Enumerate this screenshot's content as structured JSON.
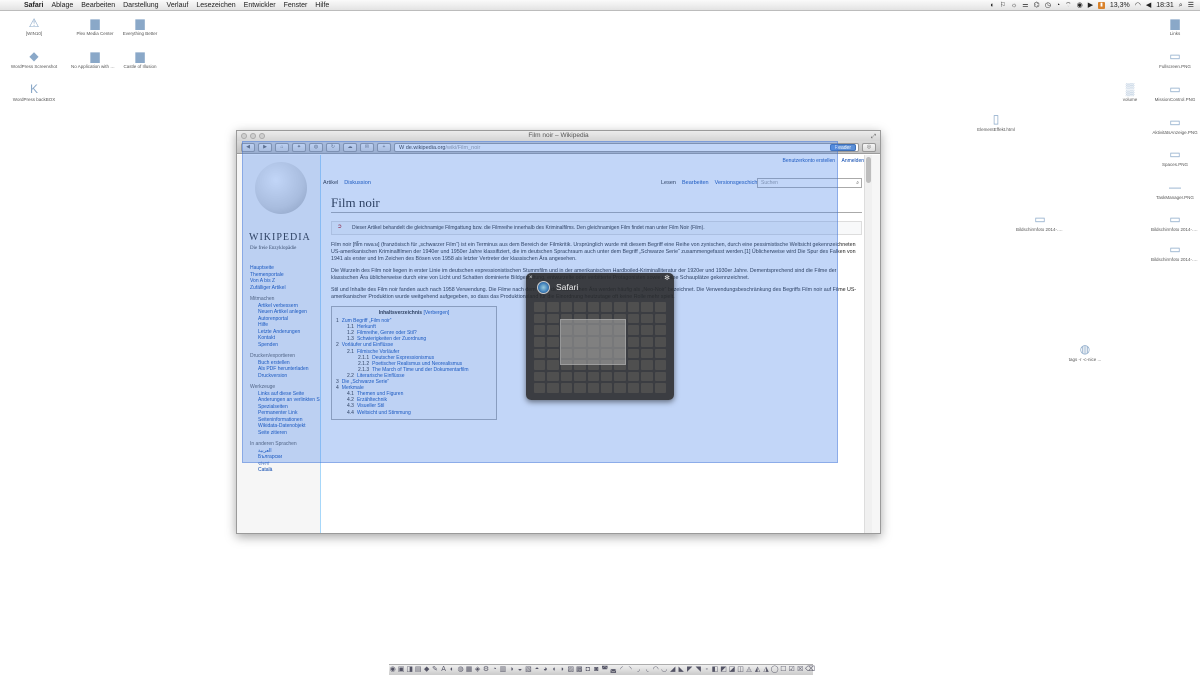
{
  "menubar": {
    "apple": "",
    "items": [
      "Safari",
      "Ablage",
      "Bearbeiten",
      "Darstellung",
      "Verlauf",
      "Lesezeichen",
      "Entwickler",
      "Fenster",
      "Hilfe"
    ],
    "battery_percent": "13,3%",
    "time": "18:31",
    "status_icons": [
      "◐",
      "⚐",
      "☼",
      "⚌",
      "⌬",
      "◷",
      "◔",
      "⌔",
      "◉",
      "▶"
    ]
  },
  "desktop": {
    "icons": [
      {
        "label": "[WIN10]",
        "glyph": "⚠"
      },
      {
        "label": "Plex Media Center",
        "glyph": "▆"
      },
      {
        "label": "Everything Better",
        "glyph": "▆"
      },
      {
        "label": "WordPress Screenshot",
        "glyph": "◆"
      },
      {
        "label": "No Application with WEBFAIL",
        "glyph": "▆"
      },
      {
        "label": "Castle of Illusion",
        "glyph": "▆"
      },
      {
        "label": "WordPress backBOX",
        "glyph": "K"
      },
      {
        "label": "Links",
        "glyph": "▆"
      },
      {
        "label": "Fullscreen.PNG",
        "glyph": "▭"
      },
      {
        "label": "volume",
        "glyph": "▒"
      },
      {
        "label": "MissionControl.PNG",
        "glyph": "▭"
      },
      {
        "label": "AktivitätsAnzeige.PNG",
        "glyph": "▭"
      },
      {
        "label": "Spaces.PNG",
        "glyph": "▭"
      },
      {
        "label": "TaskManager.PNG",
        "glyph": "—"
      },
      {
        "label": "Bildschirmfoto 2014-...18.09",
        "glyph": "▭"
      },
      {
        "label": "Bildschirmfoto 2014-...18.57.03",
        "glyph": "▭"
      },
      {
        "label": "ElementEffekt.html",
        "glyph": "▯"
      },
      {
        "label": "Bildschirmfoto 2014-...18.09.45",
        "glyph": "▭"
      },
      {
        "label": "tags -r -c-nice ...",
        "glyph": "◍"
      }
    ]
  },
  "window": {
    "title": "Film noir – Wikipedia",
    "address_host": "de.wikipedia.org",
    "address_path": "/wiki/Film_noir",
    "address_prefix": "W",
    "reader_label": "Reader",
    "toolbar_buttons": [
      "◀",
      "▶",
      "⌂",
      "✦",
      "◍",
      "↻",
      "☁",
      "✉",
      "+"
    ]
  },
  "wiki": {
    "wordmark": "WIKIPEDIA",
    "tagline": "Die freie Enzyklopädie",
    "personal": [
      "Benutzerkonto erstellen",
      "Anmelden"
    ],
    "tabs_left": [
      "Artikel",
      "Diskussion"
    ],
    "tabs_right": [
      "Lesen",
      "Bearbeiten",
      "Versionsgeschichte"
    ],
    "search_placeholder": "Suchen",
    "nav": [
      {
        "label": "Hauptseite",
        "type": "link"
      },
      {
        "label": "Themenportale",
        "type": "link"
      },
      {
        "label": "Von A bis Z",
        "type": "link"
      },
      {
        "label": "Zufälliger Artikel",
        "type": "link"
      },
      {
        "label": "Mitmachen",
        "type": "head"
      },
      {
        "label": "Artikel verbessern",
        "type": "sub"
      },
      {
        "label": "Neuen Artikel anlegen",
        "type": "sub"
      },
      {
        "label": "Autorenportal",
        "type": "sub"
      },
      {
        "label": "Hilfe",
        "type": "sub"
      },
      {
        "label": "Letzte Änderungen",
        "type": "sub"
      },
      {
        "label": "Kontakt",
        "type": "sub"
      },
      {
        "label": "Spenden",
        "type": "sub"
      },
      {
        "label": "Drucken/exportieren",
        "type": "head"
      },
      {
        "label": "Buch erstellen",
        "type": "sub"
      },
      {
        "label": "Als PDF herunterladen",
        "type": "sub"
      },
      {
        "label": "Druckversion",
        "type": "sub"
      },
      {
        "label": "Werkzeuge",
        "type": "head"
      },
      {
        "label": "Links auf diese Seite",
        "type": "sub"
      },
      {
        "label": "Änderungen an verlinkten Seiten",
        "type": "sub"
      },
      {
        "label": "Spezialseiten",
        "type": "sub"
      },
      {
        "label": "Permanenter Link",
        "type": "sub"
      },
      {
        "label": "Seiteninformationen",
        "type": "sub"
      },
      {
        "label": "Wikidata-Datenobjekt",
        "type": "sub"
      },
      {
        "label": "Seite zitieren",
        "type": "sub"
      },
      {
        "label": "In anderen Sprachen",
        "type": "head"
      },
      {
        "label": "العربية",
        "type": "sub"
      },
      {
        "label": "Български",
        "type": "sub"
      },
      {
        "label": "বাংলা",
        "type": "sub"
      },
      {
        "label": "Català",
        "type": "sub"
      }
    ],
    "title": "Film noir",
    "hatnote": "Dieser Artikel behandelt die gleichnamige Filmgattung bzw. die Filmreihe innerhalb des Kriminalfilms. Den gleichnamigen Film findet man unter Film Noir (Film).",
    "paragraphs": [
      "Film noir [fil̃m nwaːʁ] (französisch für „schwarzer Film“) ist ein Terminus aus dem Bereich der Filmkritik. Ursprünglich wurde mit diesem Begriff eine Reihe von zynischen, durch eine pessimistische Weltsicht gekennzeichneten US-amerikanischen Kriminalfilmen der 1940er und 1950er Jahre klassifiziert, die im deutschen Sprachraum auch unter dem Begriff „Schwarze Serie“ zusammengefasst werden.[1] Üblicherweise wird Die Spur des Falken von 1941 als erster und Im Zeichen des Bösen von 1958 als letzter Vertreter der klassischen Ära angesehen.",
      "Die Wurzeln des Film noir liegen in erster Linie im deutschen expressionistischen Stummfilm und in der amerikanischen Hardboiled-Kriminalliteratur der 1920er und 1930er Jahre. Dementsprechend sind die Filme der klassischen Ära üblicherweise durch eine von Licht und Schatten dominierte Bildgestaltung, entwurzelte oder verbitterte Protagonisten sowie urbane Schauplätze gekennzeichnet.",
      "Stil und Inhalte des Film noir fanden auch nach 1958 Verwendung. Die Filme nach dem Ende der klassischen Ära werden häufig als „Neo-Noir“ bezeichnet. Die Verwendungsbeschränkung des Begriffs Film noir auf Filme US-amerikanischer Produktion wurde weitgehend aufgegeben, so dass das Produktionsland für die Einordnung heutzutage oft keine Rolle mehr spielt."
    ],
    "toc_title": "Inhaltsverzeichnis",
    "toc_hide": "[Verbergen]",
    "toc": [
      {
        "num": "1",
        "label": "Zum Begriff „Film noir“",
        "level": 1
      },
      {
        "num": "1.1",
        "label": "Herkunft",
        "level": 2
      },
      {
        "num": "1.2",
        "label": "Filmreihe, Genre oder Stil?",
        "level": 2
      },
      {
        "num": "1.3",
        "label": "Schwierigkeiten der Zuordnung",
        "level": 2
      },
      {
        "num": "2",
        "label": "Vorläufer und Einflüsse",
        "level": 1
      },
      {
        "num": "2.1",
        "label": "Filmische Vorläufer",
        "level": 2
      },
      {
        "num": "2.1.1",
        "label": "Deutscher Expressionismus",
        "level": 3
      },
      {
        "num": "2.1.2",
        "label": "Poetischer Realismus und Neorealismus",
        "level": 3
      },
      {
        "num": "2.1.3",
        "label": "The March of Time und der Dokumentarfilm",
        "level": 3
      },
      {
        "num": "2.2",
        "label": "Literarische Einflüsse",
        "level": 2
      },
      {
        "num": "3",
        "label": "Die „Schwarze Serie“",
        "level": 1
      },
      {
        "num": "4",
        "label": "Merkmale",
        "level": 1
      },
      {
        "num": "4.1",
        "label": "Themen und Figuren",
        "level": 2
      },
      {
        "num": "4.2",
        "label": "Erzähltechnik",
        "level": 2
      },
      {
        "num": "4.3",
        "label": "Visueller Stil",
        "level": 2
      },
      {
        "num": "4.4",
        "label": "Weltsicht und Stimmung",
        "level": 2
      }
    ]
  },
  "hud": {
    "title": "Safari",
    "close": "×",
    "gear": "✻"
  },
  "dock": {
    "items": [
      "◉",
      "▣",
      "◨",
      "▤",
      "◆",
      "✎",
      "A",
      "◐",
      "◍",
      "▦",
      "◈",
      "⚙",
      "◔",
      "▥",
      "◑",
      "◒",
      "▧",
      "◓",
      "◕",
      "◖",
      "◗",
      "▨",
      "▩",
      "◘",
      "◙",
      "◚",
      "◛",
      "◜",
      "◝",
      "◞",
      "◟",
      "◠",
      "◡",
      "◢",
      "◣",
      "◤",
      "◥",
      "◦",
      "◧",
      "◩",
      "◪",
      "◫",
      "◬",
      "◭",
      "◮",
      "◯",
      "☐",
      "☑",
      "☒",
      "⌫"
    ]
  }
}
